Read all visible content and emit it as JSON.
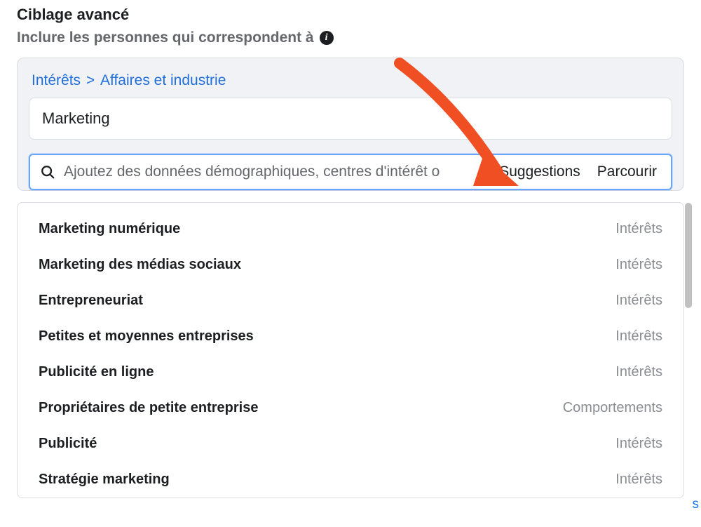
{
  "heading": "Ciblage avancé",
  "subheading": "Inclure les personnes qui correspondent à",
  "breadcrumb": {
    "root": "Intérêts",
    "child": "Affaires et industrie"
  },
  "chip": "Marketing",
  "search": {
    "placeholder": "Ajoutez des données démographiques, centres d'intérêt o",
    "suggestions_btn": "Suggestions",
    "browse_btn": "Parcourir"
  },
  "items": [
    {
      "label": "Marketing numérique",
      "cat": "Intérêts"
    },
    {
      "label": "Marketing des médias sociaux",
      "cat": "Intérêts"
    },
    {
      "label": "Entrepreneuriat",
      "cat": "Intérêts"
    },
    {
      "label": "Petites et moyennes entreprises",
      "cat": "Intérêts"
    },
    {
      "label": "Publicité en ligne",
      "cat": "Intérêts"
    },
    {
      "label": "Propriétaires de petite entreprise",
      "cat": "Comportements"
    },
    {
      "label": "Publicité",
      "cat": "Intérêts"
    },
    {
      "label": "Stratégie marketing",
      "cat": "Intérêts"
    }
  ]
}
